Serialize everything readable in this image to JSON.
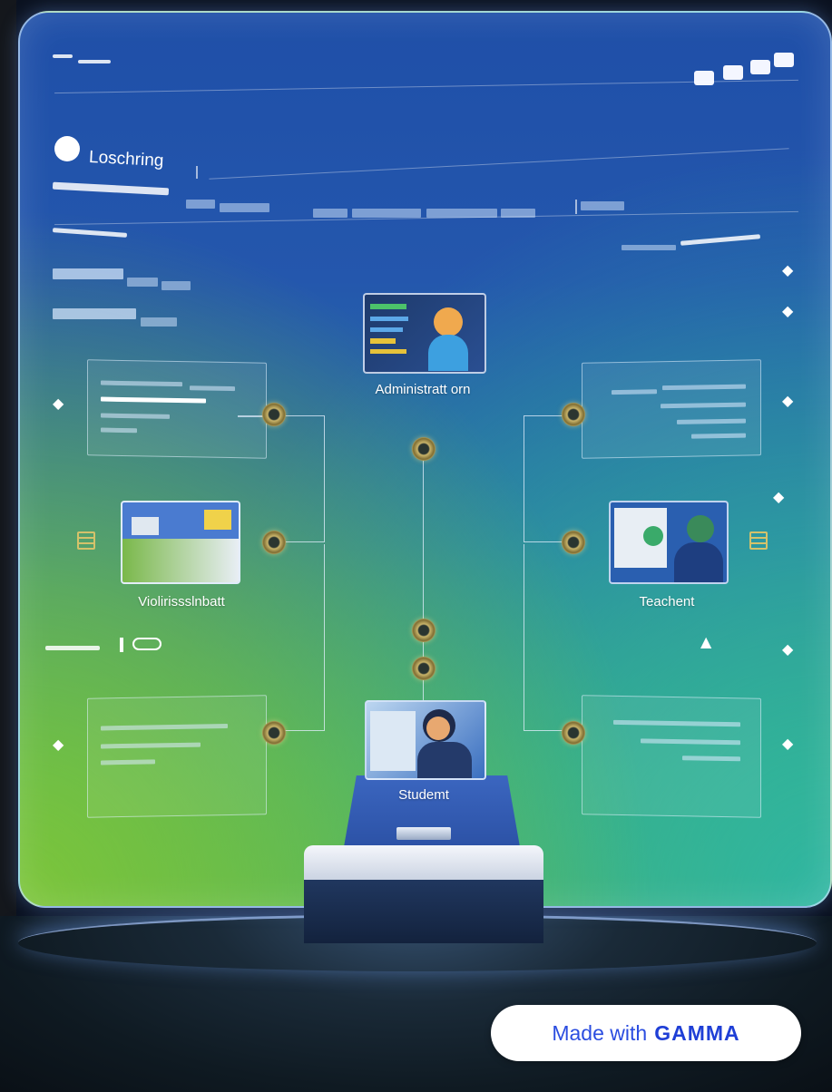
{
  "header": {
    "app_title": "Loschring"
  },
  "nodes": {
    "top": "Administratt orn",
    "left": "Violirissslnbatt",
    "right": "Teachent",
    "bottom": "Studemt"
  },
  "badge": {
    "made_with": "Made with",
    "brand": "GAMMA"
  },
  "colors": {
    "panel_top": "#1f4fa8",
    "panel_bottom_left": "#7cc53a",
    "panel_bottom_right": "#2fb6a2",
    "node_gold": "#c9b46a",
    "badge_text": "#2b4de0"
  }
}
